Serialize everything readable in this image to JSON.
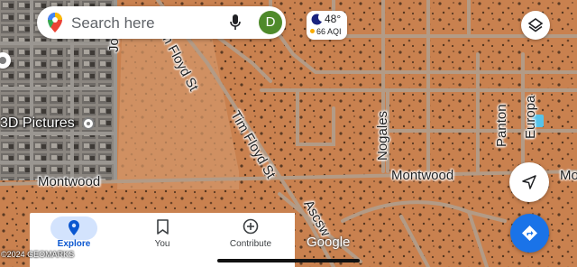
{
  "search": {
    "placeholder": "Search here",
    "avatar_initial": "D"
  },
  "weather": {
    "temperature": "48°",
    "aqi": "66 AQI"
  },
  "map": {
    "place_label": "3D Pictures",
    "streets": {
      "jobe": "Jobe",
      "tim_floyd_upper": "Tim Floyd St",
      "tim_floyd_lower": "Tim Floyd St",
      "nogales": "Nogales",
      "panton": "Panton",
      "europa": "Europa",
      "montwood_left": "Montwood",
      "montwood_right": "Montwood",
      "montwood_edge": "Mo",
      "ascsw": "Ascsw"
    },
    "logo": "Google",
    "attribution": "©2024 GEOMARKS"
  },
  "bottom_nav": {
    "items": [
      {
        "label": "Explore",
        "icon": "location-pin-icon",
        "active": true
      },
      {
        "label": "You",
        "icon": "bookmark-icon",
        "active": false
      },
      {
        "label": "Contribute",
        "icon": "add-circle-icon",
        "active": false
      }
    ]
  },
  "colors": {
    "accent": "#1a73e8",
    "active_pill": "#d3e3fd",
    "terrain": "#c57a4f"
  }
}
